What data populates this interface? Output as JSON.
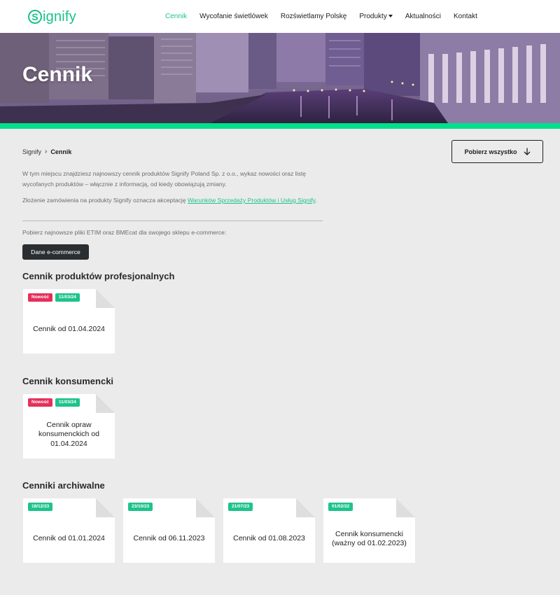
{
  "header": {
    "logo_initial": "S",
    "logo_rest": "ignify",
    "nav": [
      {
        "label": "Cennik",
        "active": true
      },
      {
        "label": "Wycofanie świetlówek",
        "active": false
      },
      {
        "label": "Rozświetlamy Polskę",
        "active": false
      },
      {
        "label": "Produkty",
        "active": false,
        "dropdown": true
      },
      {
        "label": "Aktualności",
        "active": false
      },
      {
        "label": "Kontakt",
        "active": false
      }
    ]
  },
  "hero": {
    "title": "Cennik"
  },
  "breadcrumb": {
    "home": "Signify",
    "current": "Cennik"
  },
  "download_all": {
    "label": "Pobierz wszystko"
  },
  "intro": {
    "text": "W tym miejscu znajdziesz najnowszy cennik produktów Signify Poland Sp. z o.o., wykaz nowości oraz listę wycofanych produktów – włącznie z informacją, od kiedy obowiązują zmiany.",
    "terms_prefix": "Złożenie zamówienia na produkty Signify oznacza akceptację ",
    "terms_link": "Warunków Sprzedaży Produktów i Usług Signify",
    "terms_suffix": ".",
    "etim_text": "Pobierz najnowsze pliki ETIM oraz BMEcat dla swojego sklepu e-commerce:",
    "ecommerce_button": "Dane e-commerce"
  },
  "sections": {
    "professional": {
      "title": "Cennik produktów profesjonalnych",
      "cards": [
        {
          "new": "Nowość",
          "date": "11/03/24",
          "label": "Cennik od 01.04.2024"
        }
      ]
    },
    "consumer": {
      "title": "Cennik konsumencki",
      "cards": [
        {
          "new": "Nowość",
          "date": "11/03/24",
          "label": "Cennik opraw konsumenckich od 01.04.2024"
        }
      ]
    },
    "archive": {
      "title": "Cenniki archiwalne",
      "cards": [
        {
          "date": "18/12/23",
          "label": "Cennik od 01.01.2024"
        },
        {
          "date": "23/10/23",
          "label": "Cennik od 06.11.2023"
        },
        {
          "date": "21/07/23",
          "label": "Cennik od 01.08.2023"
        },
        {
          "date": "01/02/22",
          "label": "Cennik konsumencki (ważny od 01.02.2023)"
        }
      ]
    }
  },
  "colors": {
    "brand": "#1ec38c",
    "accent_bar": "#00e08a",
    "new_badge": "#e3305a",
    "dark_button": "#2b2e30"
  },
  "icons": {
    "download": "arrow-down-icon",
    "breadcrumb_separator": "chevron-right-icon",
    "dropdown": "caret-down-icon"
  }
}
